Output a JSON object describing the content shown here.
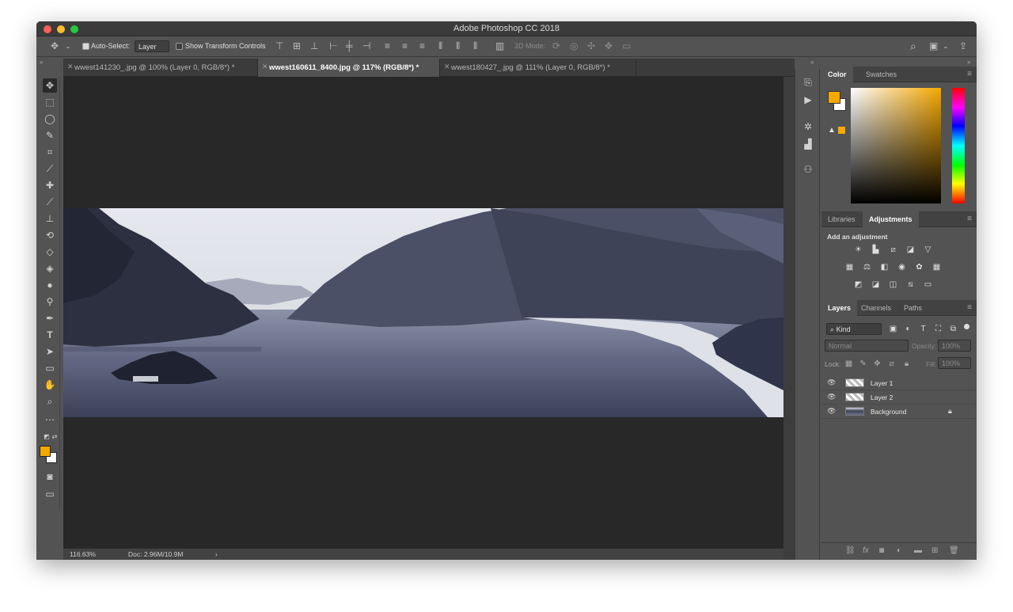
{
  "window": {
    "title": "Adobe Photoshop CC 2018"
  },
  "options_bar": {
    "auto_select_label": "Auto-Select:",
    "auto_select_value": "Layer",
    "show_transform_label": "Show Transform Controls",
    "mode_3d_label": "3D Mode:"
  },
  "tabs": [
    {
      "label": "wwest141230_.jpg @ 100% (Layer 0, RGB/8*) *",
      "active": false
    },
    {
      "label": "wwest160611_8400.jpg @ 117% (RGB/8*) *",
      "active": true
    },
    {
      "label": "wwest180427_.jpg @ 111% (Layer 0, RGB/8*) *",
      "active": false
    }
  ],
  "status": {
    "zoom": "116.63%",
    "doc": "Doc: 2.96M/10.9M",
    "arrow": "›"
  },
  "color_panel": {
    "tabs": [
      "Color",
      "Swatches"
    ],
    "foreground": "#F5A800",
    "background": "#FFFFFF"
  },
  "adjustments_panel": {
    "tabs": [
      "Libraries",
      "Adjustments"
    ],
    "heading": "Add an adjustment"
  },
  "layers_panel": {
    "tabs": [
      "Layers",
      "Channels",
      "Paths"
    ],
    "kind_label": "Kind",
    "blend_mode": "Normal",
    "opacity_label": "Opacity:",
    "opacity_value": "100%",
    "lock_label": "Lock:",
    "fill_label": "Fill:",
    "fill_value": "100%",
    "layers": [
      {
        "name": "Layer 1"
      },
      {
        "name": "Layer 2"
      },
      {
        "name": "Background"
      }
    ]
  },
  "colors": {
    "accent": "#F5A800",
    "chrome": "#535353",
    "canvas": "#282828"
  }
}
